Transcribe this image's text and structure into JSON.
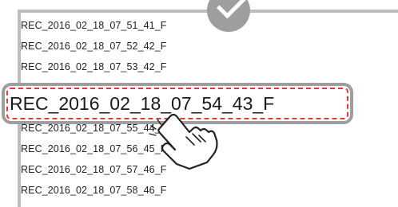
{
  "file_list": {
    "items": [
      "REC_2016_02_18_07_51_41_F",
      "REC_2016_02_18_07_52_42_F",
      "REC_2016_02_18_07_53_42_F",
      "REC_2016_02_18_07_55_44_F",
      "REC_2016_02_18_07_56_45_F",
      "REC_2016_02_18_07_57_46_F",
      "REC_2016_02_18_07_58_46_F"
    ],
    "selected": "REC_2016_02_18_07_54_43_F"
  },
  "colors": {
    "highlight_dash": "#e0393c",
    "frame": "#9e9e9e"
  },
  "icons": {
    "badge": "check-icon",
    "pointer": "hand-cursor-icon"
  }
}
